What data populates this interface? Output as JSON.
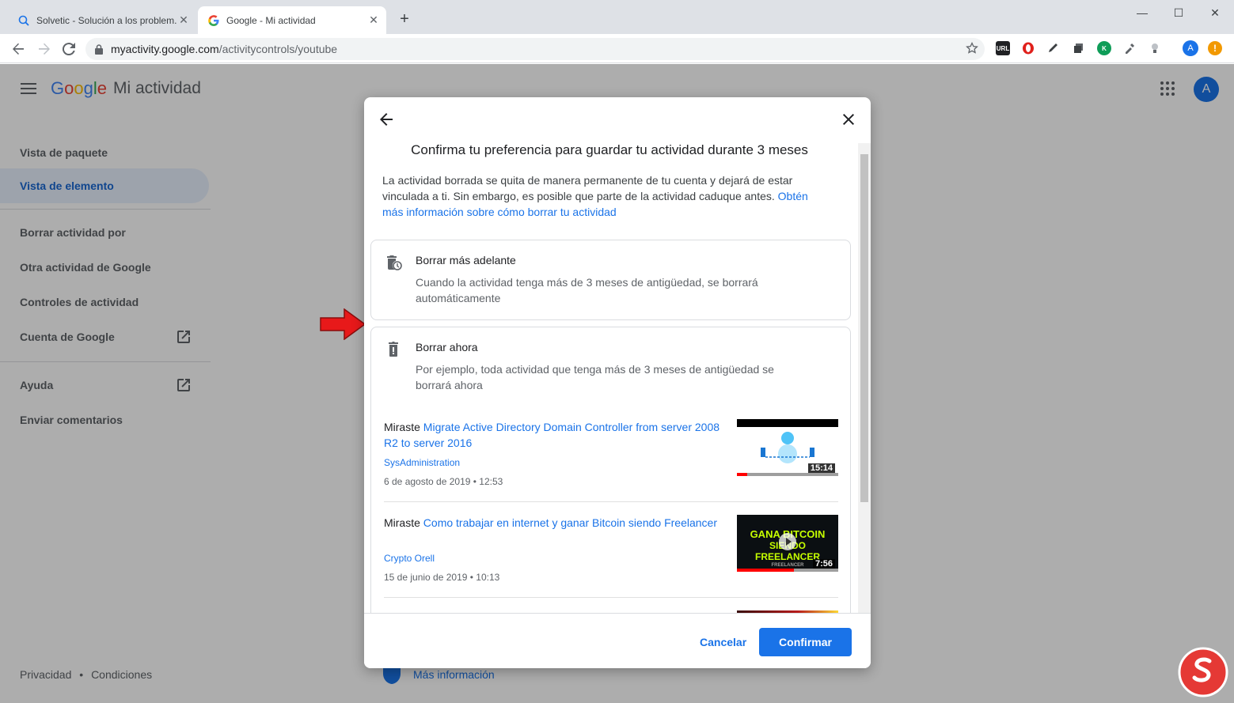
{
  "browser": {
    "tabs": [
      {
        "title": "Solvetic - Solución a los problem..."
      },
      {
        "title": "Google - Mi actividad"
      }
    ],
    "url_host": "myactivity.google.com",
    "url_path": "/activitycontrols/youtube",
    "profile_initial": "A"
  },
  "header": {
    "logo_letters": [
      "G",
      "o",
      "o",
      "g",
      "l",
      "e"
    ],
    "product": "Mi actividad",
    "avatar_initial": "A"
  },
  "sidebar": {
    "items": [
      {
        "label": "Vista de paquete"
      },
      {
        "label": "Vista de elemento"
      },
      {
        "label": "Borrar actividad por"
      },
      {
        "label": "Otra actividad de Google"
      },
      {
        "label": "Controles de actividad"
      },
      {
        "label": "Cuenta de Google"
      },
      {
        "label": "Ayuda"
      },
      {
        "label": "Enviar comentarios"
      }
    ],
    "footer_privacy": "Privacidad",
    "footer_sep": "•",
    "footer_terms": "Condiciones"
  },
  "under_dialog_link": "Más información",
  "dialog": {
    "title": "Confirma tu preferencia para guardar tu actividad durante 3 meses",
    "desc": "La actividad borrada se quita de manera permanente de tu cuenta y dejará de estar vinculada a ti. Sin embargo, es posible que parte de la actividad caduque antes.",
    "desc_link": "Obtén más información sobre cómo borrar tu actividad",
    "options": [
      {
        "title": "Borrar más adelante",
        "desc": "Cuando la actividad tenga más de 3 meses de antigüedad, se borrará automáticamente"
      },
      {
        "title": "Borrar ahora",
        "desc": "Por ejemplo, toda actividad que tenga más de 3 meses de antigüedad se borrará ahora"
      }
    ],
    "activities": [
      {
        "prefix": "Miraste",
        "title": "Migrate Active Directory Domain Controller from server 2008 R2 to server 2016",
        "channel": "SysAdministration",
        "date": "6 de agosto de 2019 • 12:53",
        "duration": "15:14",
        "watched": 0.1
      },
      {
        "prefix": "Miraste",
        "title": "Como trabajar en internet y ganar Bitcoin siendo Freelancer",
        "channel": "Crypto Orell",
        "date": "15 de junio de 2019 • 10:13",
        "duration": "7:56",
        "watched": 0.56,
        "thumb_line1": "GANA BITCOIN",
        "thumb_line2": "SIENDO FREELANCER",
        "thumb_small": "FREELANCER"
      }
    ],
    "cancel": "Cancelar",
    "confirm": "Confirmar"
  },
  "colors": {
    "accent": "#1a73e8",
    "arrow": "#e8191a"
  }
}
